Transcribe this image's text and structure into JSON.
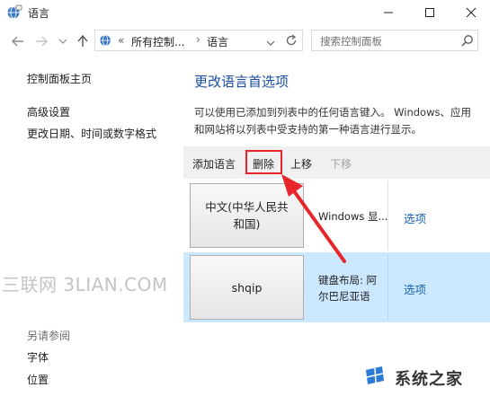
{
  "window": {
    "title": "语言"
  },
  "address": {
    "prefix": "«",
    "segments": [
      "所有控制...",
      "语言"
    ],
    "separator": "›"
  },
  "search": {
    "placeholder": "搜索控制面板"
  },
  "sidebar": {
    "home": "控制面板主页",
    "items": [
      "高级设置",
      "更改日期、时间或数字格式"
    ],
    "see_also_title": "另请参阅",
    "see_also": [
      "字体",
      "位置"
    ]
  },
  "main": {
    "heading": "更改语言首选项",
    "description": "可以使用已添加到列表中的任何语言键入。 Windows、应用和网站将以列表中受支持的第一种语言进行显示。",
    "toolbar": {
      "add": "添加语言",
      "remove": "删除",
      "move_up": "上移",
      "move_down": "下移"
    },
    "languages": [
      {
        "name": "中文(中华人民共和国)",
        "name_line1": "中文(中华人民共",
        "name_line2": "和国)",
        "info": "Windows 显...",
        "options": "选项"
      },
      {
        "name": "shqip",
        "info_line1": "键盘布局: 阿",
        "info_line2": "尔巴尼亚语",
        "options": "选项"
      }
    ]
  },
  "watermark": {
    "left": "三联网 3LIAN.COM",
    "brand": "系统之家"
  },
  "colors": {
    "highlight_row": "#cce8ff",
    "annotation": "#e8252b",
    "link": "#1a62b4",
    "heading": "#1a4ea0"
  }
}
